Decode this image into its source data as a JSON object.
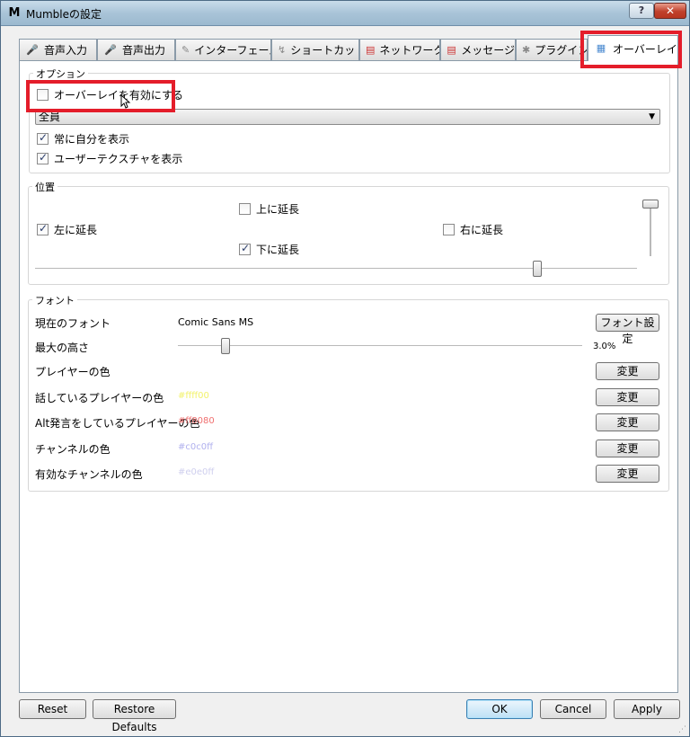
{
  "window": {
    "title": "Mumbleの設定",
    "help_label": "?",
    "close_label": "✕"
  },
  "tabs": [
    {
      "label": "音声入力",
      "icon": "microphone-icon"
    },
    {
      "label": "音声出力",
      "icon": "speaker-icon"
    },
    {
      "label": "インターフェース",
      "icon": "paint-icon"
    },
    {
      "label": "ショートカット",
      "icon": "shortcut-icon"
    },
    {
      "label": "ネットワーク",
      "icon": "network-icon"
    },
    {
      "label": "メッセージ",
      "icon": "message-icon"
    },
    {
      "label": "プラグイン",
      "icon": "plugin-icon"
    },
    {
      "label": "オーバーレイ",
      "icon": "overlay-icon",
      "active": true
    }
  ],
  "options": {
    "group_title": "オプション",
    "enable_overlay": {
      "label": "オーバーレイを有効にする",
      "checked": false
    },
    "show_select": {
      "value": "全員"
    },
    "always_self": {
      "label": "常に自分を表示",
      "checked": true
    },
    "user_texture": {
      "label": "ユーザーテクスチャを表示",
      "checked": true
    }
  },
  "position": {
    "group_title": "位置",
    "grow_up": {
      "label": "上に延長",
      "checked": false
    },
    "grow_left": {
      "label": "左に延長",
      "checked": true
    },
    "grow_right": {
      "label": "右に延長",
      "checked": false
    },
    "grow_down": {
      "label": "下に延長",
      "checked": true
    },
    "horizontal_value": 0.84,
    "vertical_value": 0.0
  },
  "font": {
    "group_title": "フォント",
    "current_font_label": "現在のフォント",
    "current_font_value": "Comic Sans MS",
    "font_button": "フォント設定",
    "max_height_label": "最大の高さ",
    "max_height_value": "3.0%",
    "max_height_slider": 0.11,
    "player_color_label": "プレイヤーの色",
    "player_color_value": "",
    "talking_color_label": "話しているプレイヤーの色",
    "talking_color_value": "#ffff00",
    "alt_color_label": "Alt発言をしているプレイヤーの色",
    "alt_color_value": "#ff8080",
    "channel_color_label": "チャンネルの色",
    "channel_color_value": "#c0c0ff",
    "active_channel_label": "有効なチャンネルの色",
    "active_channel_value": "#e0e0ff",
    "change_label": "変更"
  },
  "buttons": {
    "reset": "Reset",
    "restore": "Restore Defaults",
    "ok": "OK",
    "cancel": "Cancel",
    "apply": "Apply"
  }
}
